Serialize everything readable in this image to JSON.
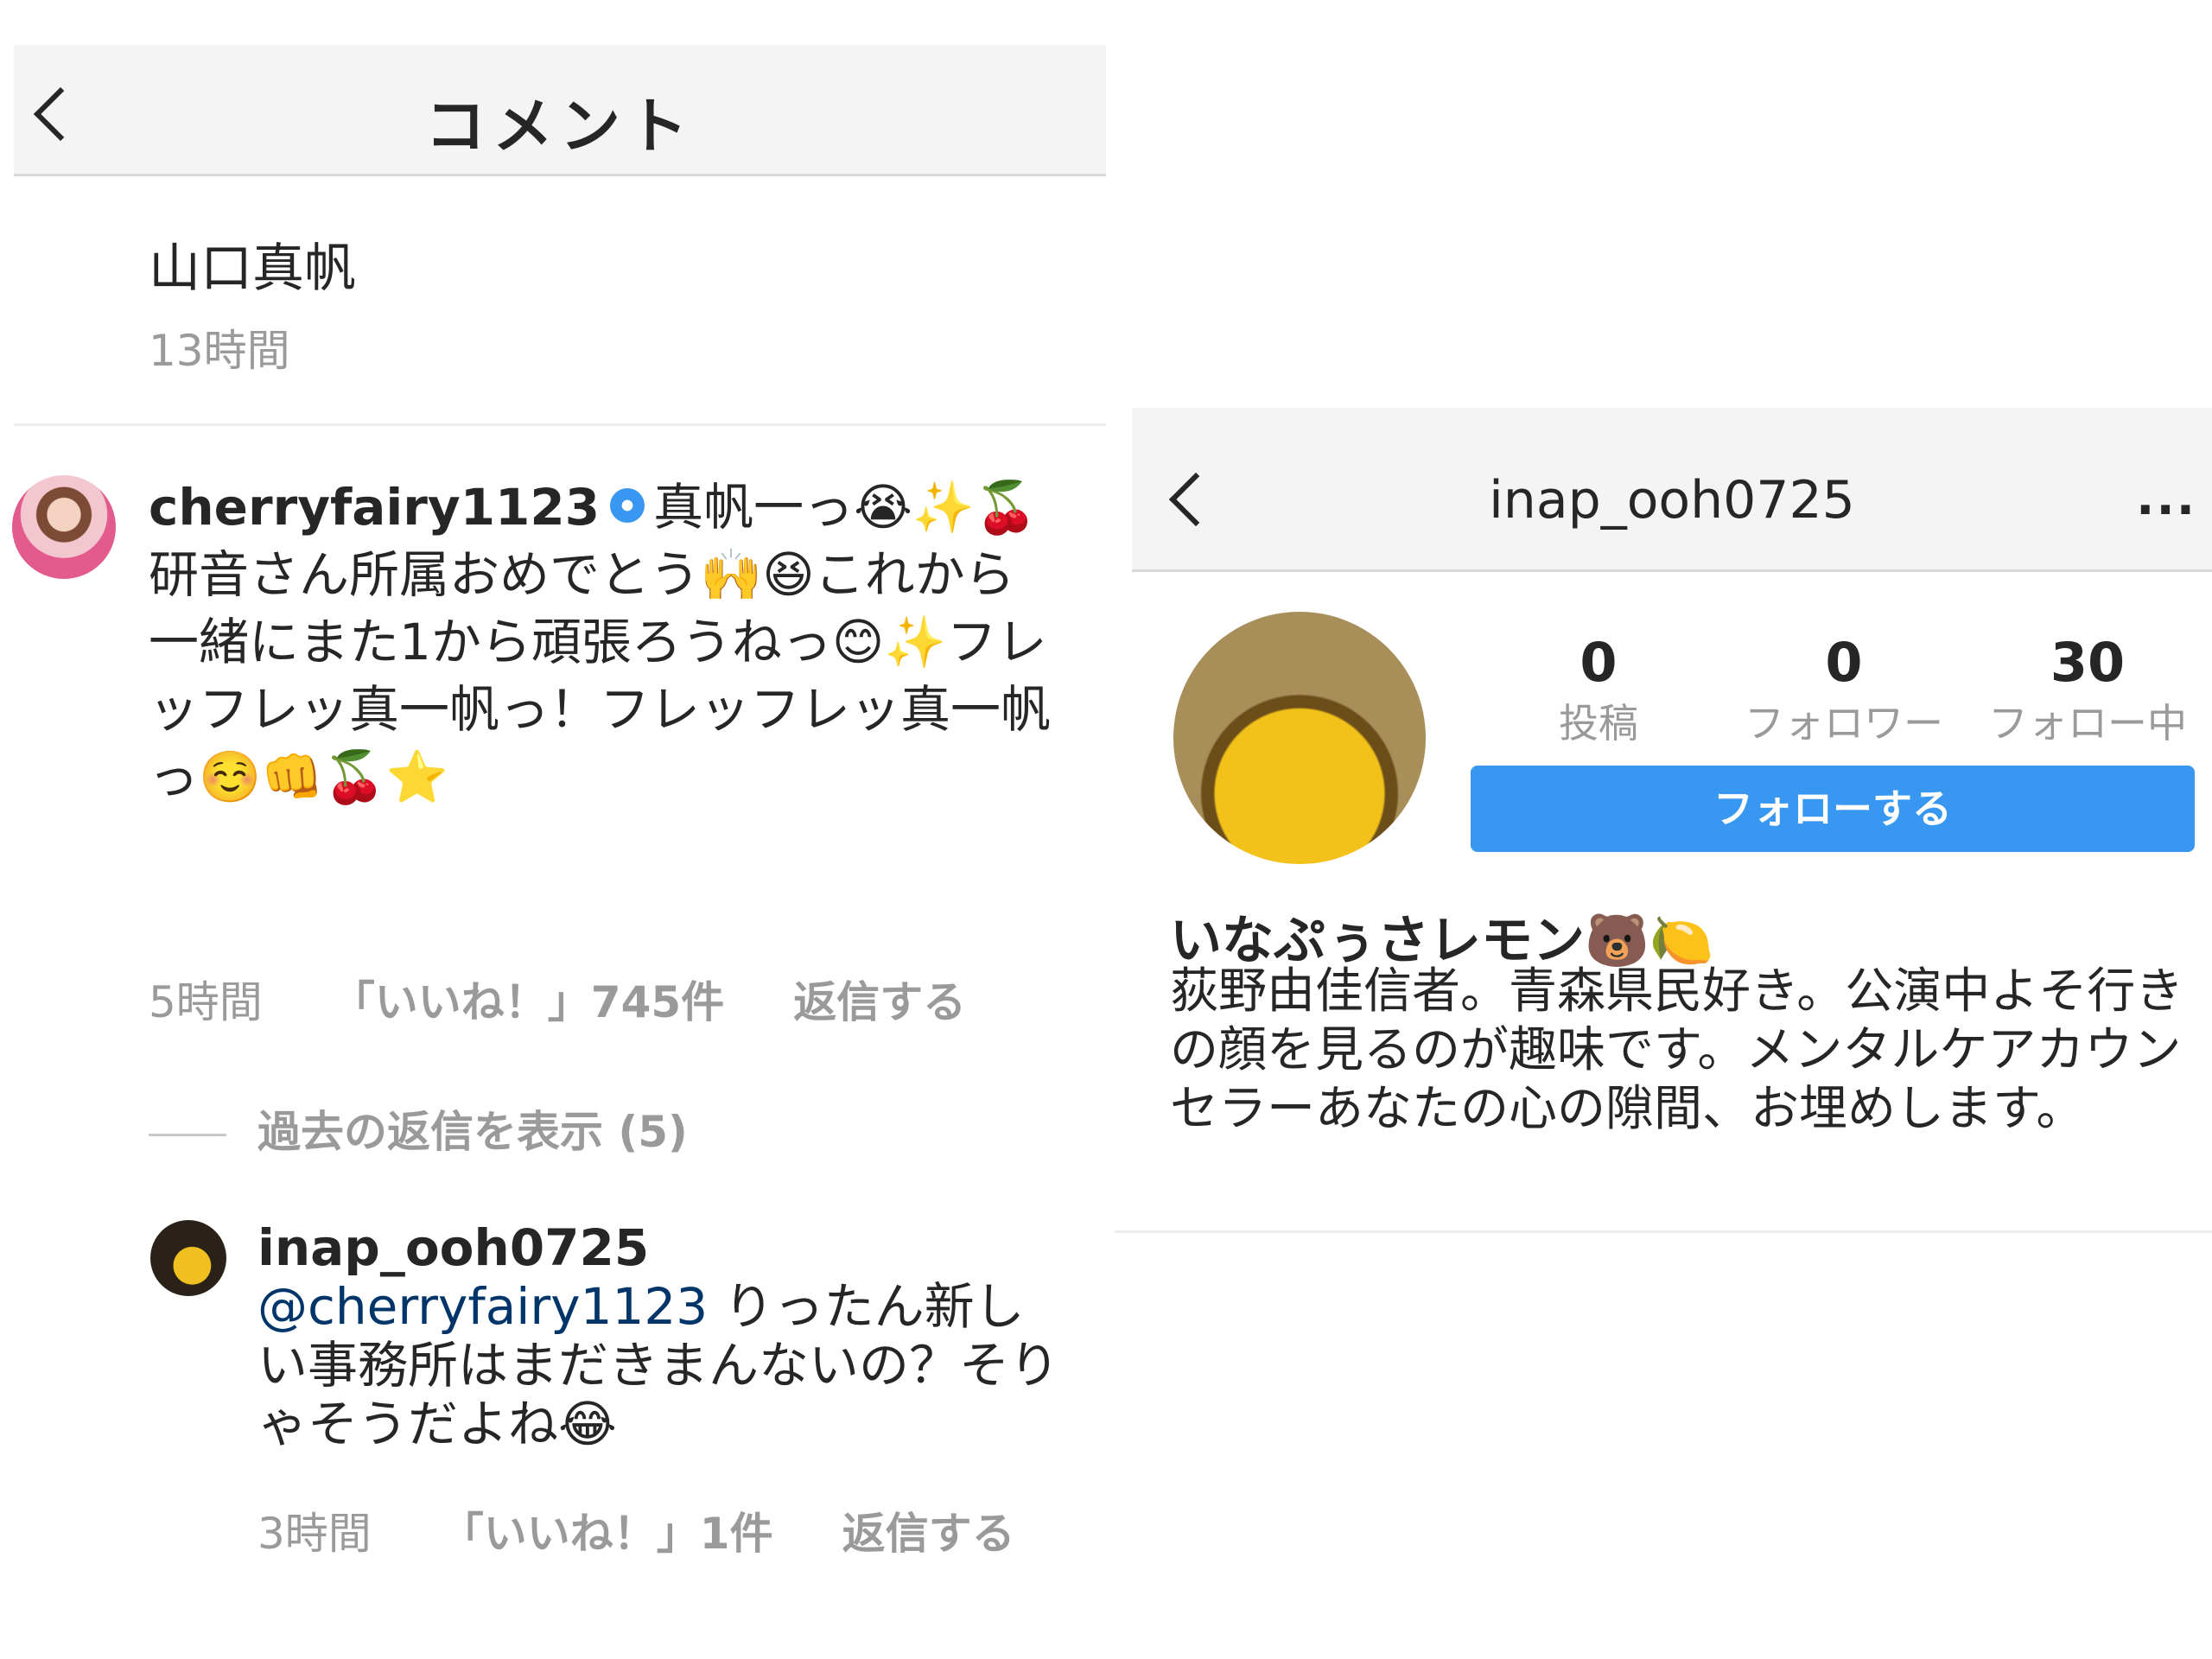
{
  "comments_screen": {
    "header": {
      "back_icon": "chevron-left-icon",
      "title": "コメント"
    },
    "post": {
      "author": "山口真帆",
      "time": "13時間"
    },
    "comment1": {
      "username": "cherryfairy1123",
      "verified_icon": "verified-badge-icon",
      "text": "真帆一っ😭✨🍒研音さん所属おめでとう🙌😆これから一緒にまた1から頑張ろうねっ😊✨フレッフレッ真一帆っ！フレッフレッ真一帆っ☺️👊🍒⭐",
      "time": "5時間",
      "likes": "「いいね！」745件",
      "reply": "返信する"
    },
    "view_replies": "過去の返信を表示 (5)",
    "reply": {
      "username": "inap_ooh0725",
      "mention": "@cherryfairy1123",
      "text": "りったん新しい事務所はまだきまんないの？そりゃそうだよね😂",
      "time": "3時間",
      "likes": "「いいね！」1件",
      "reply": "返信する"
    }
  },
  "profile_screen": {
    "header": {
      "back_icon": "chevron-left-icon",
      "username": "inap_ooh0725",
      "more": "..."
    },
    "stats": {
      "posts_count": "0",
      "posts_label": "投稿",
      "followers_count": "0",
      "followers_label": "フォロワー",
      "following_count": "30",
      "following_label": "フォロー中"
    },
    "follow_button": "フォローする",
    "display_name": "いなぷぅさレモン🐻🍋",
    "bio": "荻野由佳信者。青森県民好き。公演中よそ行きの顔を見るのが趣味です。メンタルケアカウンセラーあなたの心の隙間、お埋めします。"
  },
  "colors": {
    "accent": "#3897f0",
    "muted": "#9a9a9a",
    "header_bg": "#f4f4f4",
    "mention": "#003569"
  }
}
